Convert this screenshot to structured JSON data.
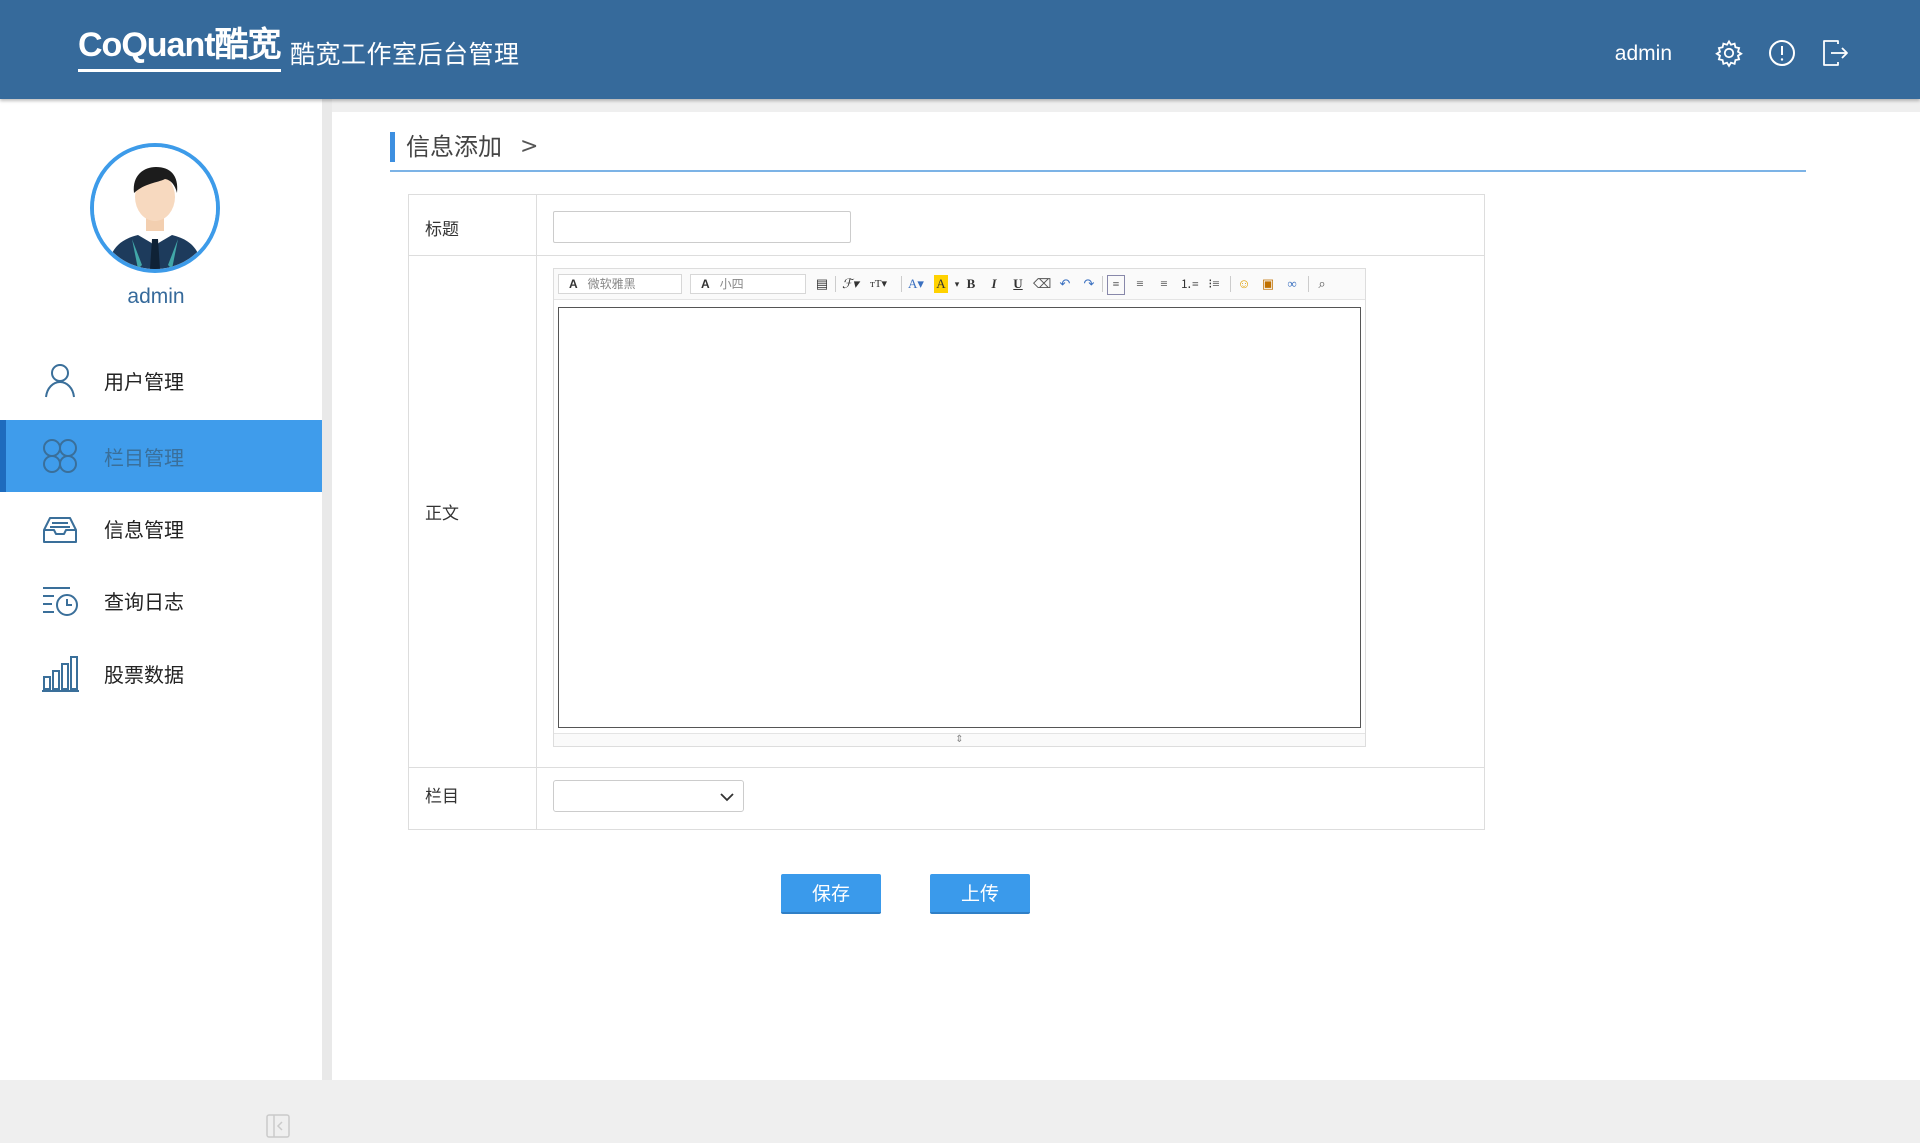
{
  "header": {
    "logo_text": "CoQuant酷宽",
    "app_title": "酷宽工作室后台管理",
    "username": "admin",
    "icons": [
      "gear-icon",
      "alert-circle-icon",
      "logout-icon"
    ]
  },
  "sidebar": {
    "username": "admin",
    "items": [
      {
        "label": "用户管理",
        "icon": "user-icon",
        "active": false
      },
      {
        "label": "栏目管理",
        "icon": "category-grid-icon",
        "active": true
      },
      {
        "label": "信息管理",
        "icon": "inbox-icon",
        "active": false
      },
      {
        "label": "查询日志",
        "icon": "history-list-icon",
        "active": false
      },
      {
        "label": "股票数据",
        "icon": "bar-chart-icon",
        "active": false
      }
    ]
  },
  "breadcrumb": {
    "title": "信息添加",
    "separator": ">"
  },
  "form": {
    "title_label": "标题",
    "title_value": "",
    "body_label": "正文",
    "category_label": "栏目",
    "category_value": ""
  },
  "editor": {
    "font_family": "微软雅黑",
    "font_size": "小四",
    "font_family_prefix": "A",
    "font_size_prefix": "A"
  },
  "buttons": {
    "save": "保存",
    "upload": "上传"
  },
  "colors": {
    "header_bg": "#366a9b",
    "accent": "#3f9ceb",
    "active_border": "#1e6bbd"
  }
}
